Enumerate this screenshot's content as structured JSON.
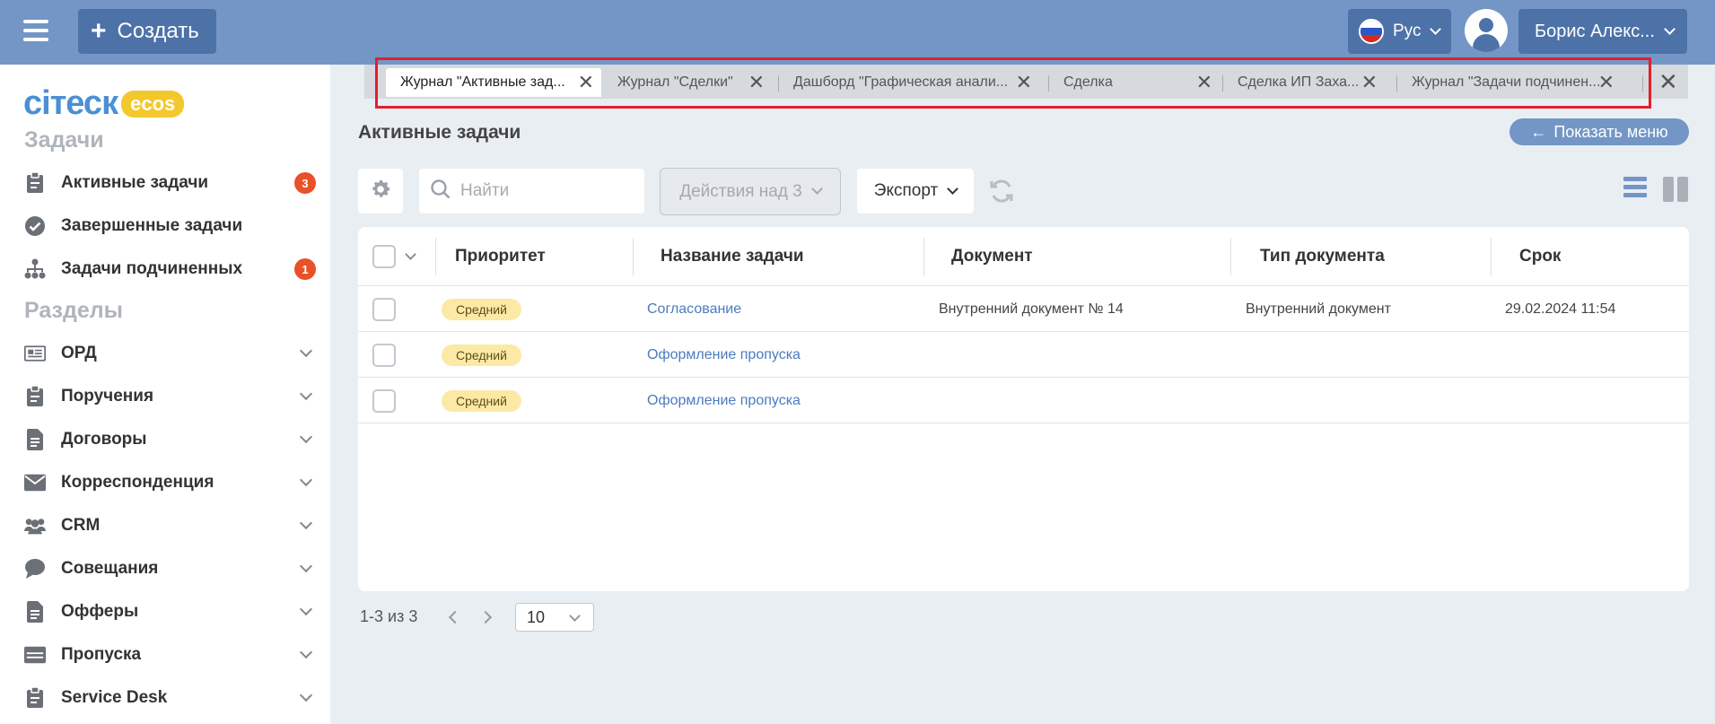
{
  "header": {
    "create_label": "Создать",
    "lang_label": "Рус",
    "user_label": "Борис Алекс..."
  },
  "sidebar": {
    "logo_text": "ciтеск",
    "logo_badge": "ecos",
    "section_tasks": "Задачи",
    "section_sections": "Разделы",
    "tasks": [
      {
        "label": "Активные задачи",
        "badge": "3",
        "icon": "clipboard-icon"
      },
      {
        "label": "Завершенные задачи",
        "badge": "",
        "icon": "check-circle-icon"
      },
      {
        "label": "Задачи подчиненных",
        "badge": "1",
        "icon": "org-chart-icon"
      }
    ],
    "sections": [
      {
        "label": "ОРД",
        "icon": "newspaper-icon"
      },
      {
        "label": "Поручения",
        "icon": "clipboard-icon"
      },
      {
        "label": "Договоры",
        "icon": "document-icon"
      },
      {
        "label": "Корреспонденция",
        "icon": "envelope-icon"
      },
      {
        "label": "CRM",
        "icon": "users-icon"
      },
      {
        "label": "Совещания",
        "icon": "chat-bubble-icon"
      },
      {
        "label": "Офферы",
        "icon": "document-icon"
      },
      {
        "label": "Пропуска",
        "icon": "card-icon"
      },
      {
        "label": "Service Desk",
        "icon": "clipboard-icon"
      }
    ]
  },
  "tabs": [
    {
      "label": "Журнал \"Активные зад...",
      "active": true
    },
    {
      "label": "Журнал \"Сделки\"",
      "active": false
    },
    {
      "label": "Дашборд \"Графическая анали...",
      "active": false
    },
    {
      "label": "Сделка",
      "active": false
    },
    {
      "label": "Сделка ИП Заха...",
      "active": false
    },
    {
      "label": "Журнал \"Задачи подчинен...",
      "active": false
    }
  ],
  "main": {
    "title": "Активные задачи",
    "show_menu_label": "Показать меню",
    "search_placeholder": "Найти",
    "actions_label": "Действия над 3",
    "export_label": "Экспорт"
  },
  "table": {
    "columns": [
      "Приоритет",
      "Название задачи",
      "Документ",
      "Тип документа",
      "Срок"
    ],
    "rows": [
      {
        "priority": "Средний",
        "name": "Согласование",
        "document": "Внутренний документ № 14",
        "doc_type": "Внутренний документ",
        "due": "29.02.2024 11:54"
      },
      {
        "priority": "Средний",
        "name": "Оформление пропуска",
        "document": "",
        "doc_type": "",
        "due": ""
      },
      {
        "priority": "Средний",
        "name": "Оформление пропуска",
        "document": "",
        "doc_type": "",
        "due": ""
      }
    ]
  },
  "pagination": {
    "range_text": "1-3 из 3",
    "page_size": "10"
  },
  "colors": {
    "header_bg": "#7396c6",
    "button_bg": "#4d72a8",
    "badge_red": "#e8512a",
    "priority_pill": "#fde9a6",
    "link": "#4c7bbd",
    "highlight_border": "#e0202a"
  }
}
